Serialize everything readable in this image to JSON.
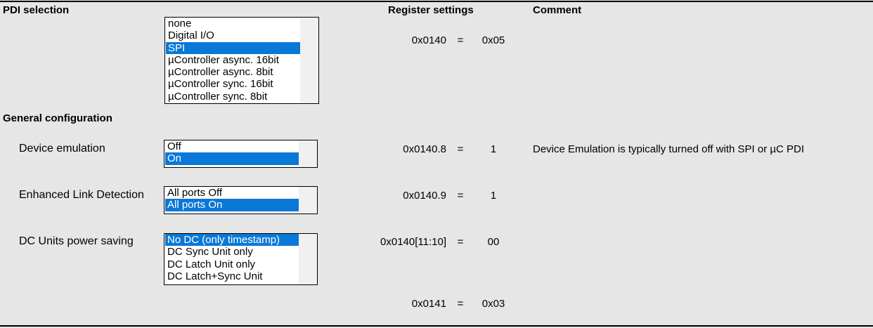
{
  "headers": {
    "pdi_selection": "PDI selection",
    "register_settings": "Register settings",
    "comment": "Comment",
    "general_configuration": "General configuration"
  },
  "pdi": {
    "options": [
      "none",
      "Digital I/O",
      "SPI",
      "µController async. 16bit",
      "µController async. 8bit",
      "µController sync. 16bit",
      "µController sync. 8bit"
    ],
    "selected": "SPI",
    "register": "0x0140",
    "equals": "=",
    "value": "0x05"
  },
  "device_emulation": {
    "label": "Device emulation",
    "options": [
      "Off",
      "On"
    ],
    "selected": "On",
    "register": "0x0140.8",
    "equals": "=",
    "value": "1",
    "comment": "Device Emulation is typically turned off with SPI or µC PDI"
  },
  "enhanced_link": {
    "label": "Enhanced Link Detection",
    "options": [
      "All ports Off",
      "All ports On"
    ],
    "selected": "All ports On",
    "register": "0x0140.9",
    "equals": "=",
    "value": "1"
  },
  "dc_units": {
    "label": "DC Units power saving",
    "options": [
      "No DC (only timestamp)",
      "DC Sync Unit only",
      "DC Latch Unit only",
      "DC Latch+Sync Unit"
    ],
    "selected": "No DC (only timestamp)",
    "register": "0x0140[11:10]",
    "equals": "=",
    "value": "00"
  },
  "footer_register": {
    "register": "0x0141",
    "equals": "=",
    "value": "0x03"
  },
  "colors": {
    "background": "#e6e6e6",
    "selection": "#0a78d7",
    "listbox_bg": "#ffffff"
  }
}
